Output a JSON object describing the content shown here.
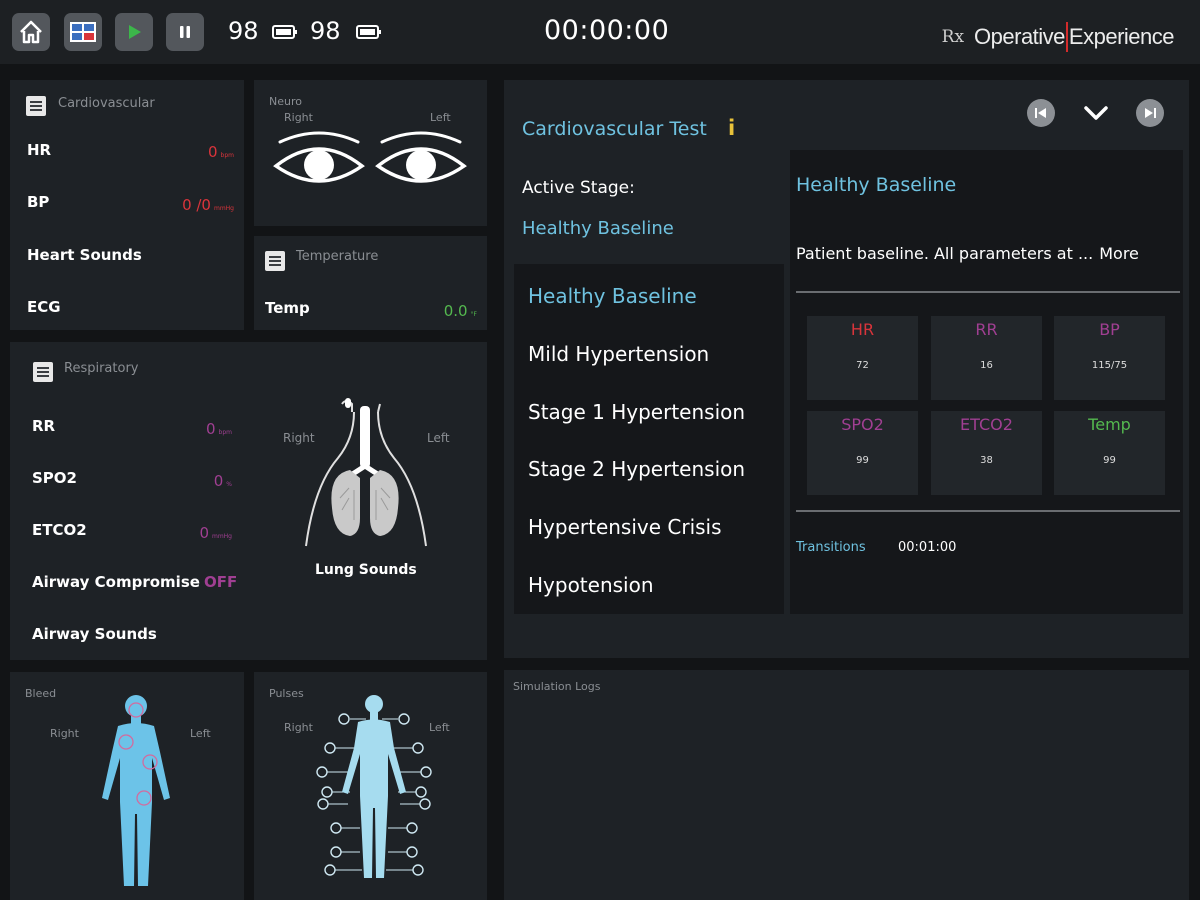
{
  "topbar": {
    "battery1": "98",
    "battery2": "98",
    "timer": "00:00:00",
    "brand": {
      "rx": "Rx",
      "word1": "Operative",
      "word2": "Experience"
    }
  },
  "cardio": {
    "title": "Cardiovascular",
    "hr": {
      "label": "HR",
      "value": "0",
      "unit": "bpm"
    },
    "bp": {
      "label": "BP",
      "value": "0 /0",
      "unit": "mmHg"
    },
    "heart_sounds": "Heart Sounds",
    "ecg": "ECG"
  },
  "neuro": {
    "title": "Neuro",
    "right": "Right",
    "left": "Left"
  },
  "temperature": {
    "title": "Temperature",
    "label": "Temp",
    "value": "0.0",
    "unit": "°F"
  },
  "respiratory": {
    "title": "Respiratory",
    "rr": {
      "label": "RR",
      "value": "0",
      "unit": "bpm"
    },
    "spo2": {
      "label": "SPO2",
      "value": "0",
      "unit": "%"
    },
    "etco2": {
      "label": "ETCO2",
      "value": "0",
      "unit": "mmHg"
    },
    "airway_compromise": {
      "label": "Airway Compromise",
      "value": "OFF"
    },
    "airway_sounds": "Airway Sounds",
    "right": "Right",
    "left": "Left",
    "lung_sounds": "Lung Sounds"
  },
  "bleed": {
    "title": "Bleed",
    "right": "Right",
    "left": "Left"
  },
  "pulses": {
    "title": "Pulses",
    "right": "Right",
    "left": "Left"
  },
  "test": {
    "title": "Cardiovascular Test",
    "info": "i",
    "active_label": "Active Stage:",
    "active_value": "Healthy Baseline",
    "stages": [
      "Healthy Baseline",
      "Mild Hypertension",
      "Stage 1 Hypertension",
      "Stage 2 Hypertension",
      "Hypertensive Crisis",
      "Hypotension"
    ],
    "detail": {
      "title": "Healthy Baseline",
      "description": "Patient baseline. All parameters at ...",
      "more": "More",
      "vitals": [
        {
          "name": "HR",
          "value": "72",
          "color": "#d9343b"
        },
        {
          "name": "RR",
          "value": "16",
          "color": "#a03f92"
        },
        {
          "name": "BP",
          "value": "115/75",
          "color": "#a03f92"
        },
        {
          "name": "SPO2",
          "value": "99",
          "color": "#a03f92"
        },
        {
          "name": "ETCO2",
          "value": "38",
          "color": "#a03f92"
        },
        {
          "name": "Temp",
          "value": "99",
          "color": "#54b94f"
        }
      ],
      "transitions_label": "Transitions",
      "transitions_value": "00:01:00"
    }
  },
  "logs": {
    "title": "Simulation Logs"
  },
  "colors": {
    "accent_blue": "#6fc2e0",
    "hr_red": "#d9343b",
    "resp_purple": "#a03f92",
    "temp_green": "#54b94f",
    "info_yellow": "#e8c23a"
  }
}
